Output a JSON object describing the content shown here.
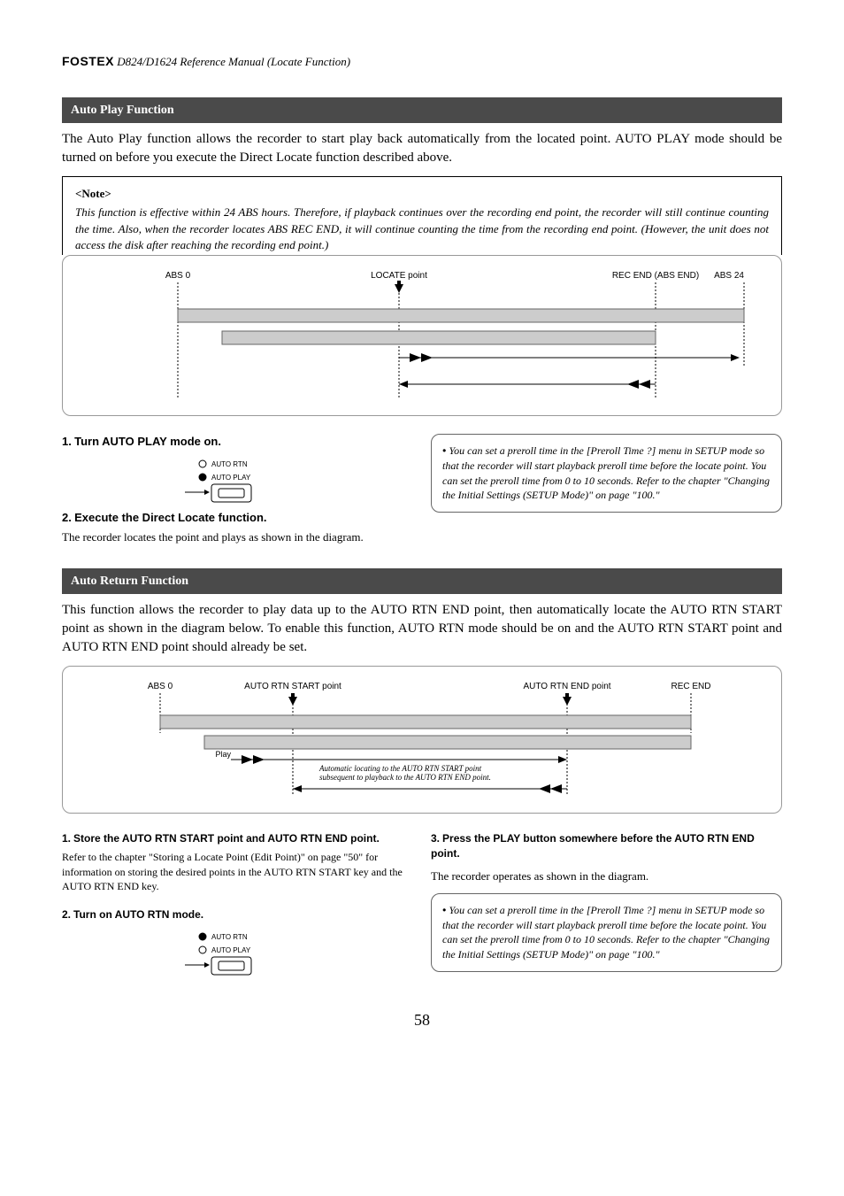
{
  "header": {
    "brand": "FOSTEX",
    "title": "D824/D1624 Reference Manual (Locate Function)"
  },
  "section1": {
    "title": "Auto Play Function",
    "intro": "The Auto Play function allows the recorder to start play back automatically from the located point. AUTO PLAY mode should be turned on before you execute the Direct Locate function described above.",
    "note_label": "<Note>",
    "note_text": "This function is effective within 24 ABS hours.  Therefore, if playback continues over the recording end point, the recorder will still continue counting the time.  Also, when the recorder locates ABS REC END, it will continue counting the time from the recording end point. (However, the unit does not access the disk after reaching the recording end point.)",
    "diag": {
      "abs0": "ABS 0",
      "locate": "LOCATE point",
      "recend": "REC END (ABS END)",
      "abs24": "ABS 24"
    },
    "step1_num": "1.",
    "step1_text": "Turn AUTO PLAY mode on.",
    "led_auto_rtn": "AUTO RTN",
    "led_auto_play": "AUTO PLAY",
    "step2_num": "2.",
    "step2_text": "Execute the Direct Locate function.",
    "result": "The recorder locates the point and plays as shown in the diagram.",
    "preroll_note": "You can set a preroll time in the [Preroll Time ?] menu in SETUP mode so that the recorder will start playback preroll time before the locate point.   You can set the preroll time from 0 to 10 seconds. Refer to the chapter \"Changing the Initial Settings (SETUP Mode)\" on page \"100.\""
  },
  "section2": {
    "title": "Auto Return Function",
    "intro": "This function allows the recorder to play data up to the AUTO RTN END point, then automatically locate the AUTO RTN START point as shown in the diagram below.   To enable this function, AUTO RTN mode should be on and the AUTO RTN START point and AUTO RTN END point should already be set.",
    "diag": {
      "abs0": "ABS 0",
      "start": "AUTO RTN START point",
      "end": "AUTO RTN END point",
      "recend": "REC END",
      "caption": "Automatic locating to the AUTO RTN START point subsequent to playback to the AUTO RTN END point."
    },
    "step1_num": "1.",
    "step1_text": "Store the AUTO RTN START point and AUTO RTN END point.",
    "step1_ref": "Refer to the chapter \"Storing a Locate Point (Edit Point)\" on page \"50\" for information on storing the desired points in the AUTO RTN START key and the AUTO RTN END key.",
    "step2_num": "2.",
    "step2_text": "Turn on AUTO RTN mode.",
    "step3_num": "3.",
    "step3_text": "Press the PLAY button somewhere before the AUTO RTN END point.",
    "result": "The recorder operates as shown in the diagram.",
    "preroll_note": "You can set a preroll time in the [Preroll Time ?] menu in SETUP mode so that the recorder will start playback preroll time before the locate point. You can set the preroll time from 0 to 10 seconds.  Refer to the chapter \"Changing the Initial Settings (SETUP Mode)\" on page \"100.\""
  },
  "page_number": "58"
}
